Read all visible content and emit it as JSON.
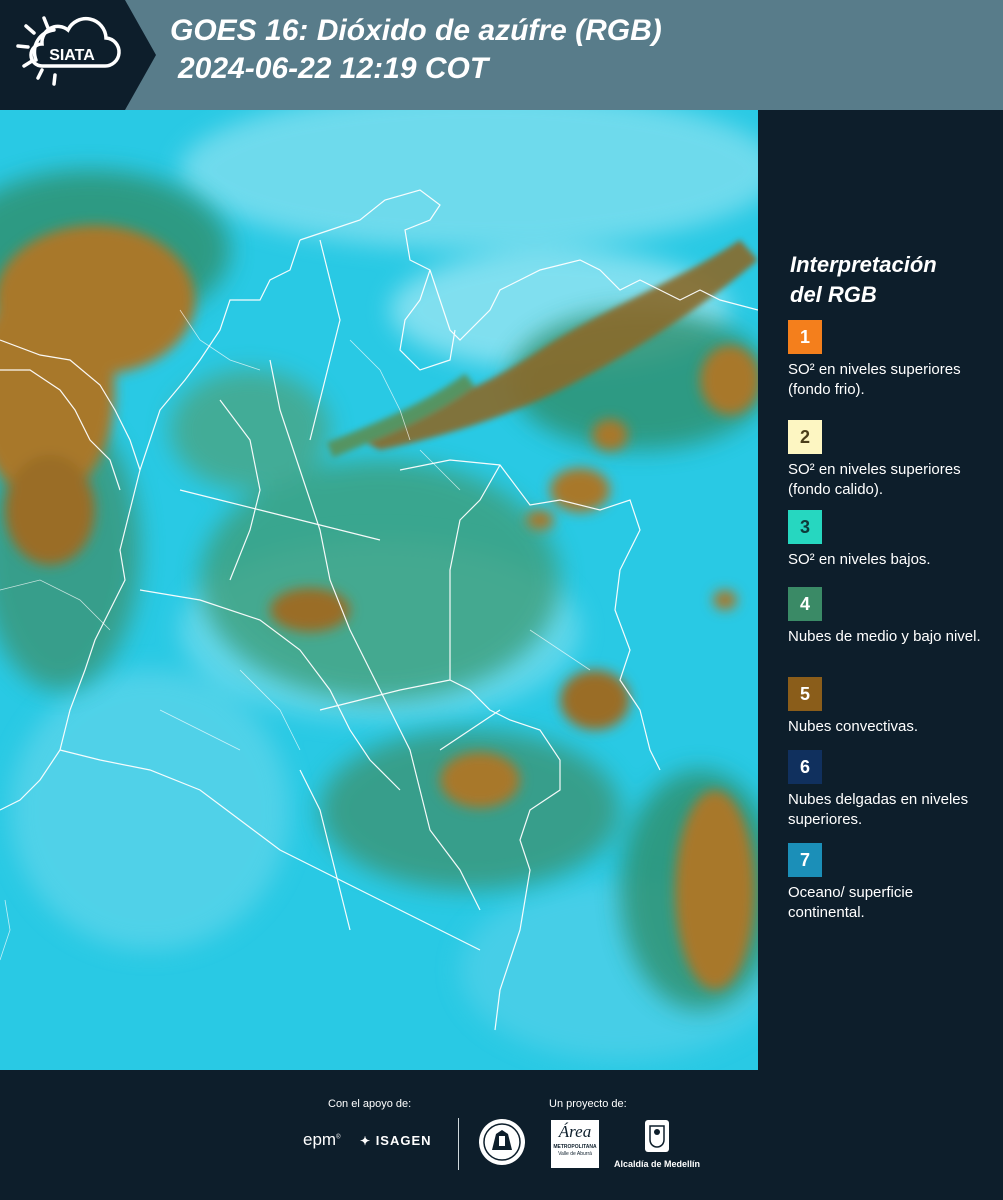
{
  "header": {
    "title": "GOES 16: Dióxido de azúfre (RGB)",
    "datetime": "2024-06-22 12:19 COT",
    "logo_text": "SIATA"
  },
  "legend": {
    "title_line1": "Interpretación",
    "title_line2": "del RGB",
    "items": [
      {
        "number": "1",
        "color": "#f47f1c",
        "num_color": "#ffffff",
        "text": "SO² en niveles superiores (fondo frio)."
      },
      {
        "number": "2",
        "color": "#fdf6c2",
        "num_color": "#4a3d1a",
        "text": "SO² en niveles superiores (fondo calido)."
      },
      {
        "number": "3",
        "color": "#26d7c0",
        "num_color": "#0d3b3a",
        "text": "SO² en niveles bajos."
      },
      {
        "number": "4",
        "color": "#3a8a66",
        "num_color": "#ffffff",
        "text": "Nubes de medio y bajo nivel."
      },
      {
        "number": "5",
        "color": "#8a5d1a",
        "num_color": "#ffffff",
        "text": "Nubes convectivas."
      },
      {
        "number": "6",
        "color": "#10305e",
        "num_color": "#ffffff",
        "text": "Nubes delgadas en niveles superiores."
      },
      {
        "number": "7",
        "color": "#1b8fb8",
        "num_color": "#ffffff",
        "text": "Oceano/ superficie continental."
      }
    ]
  },
  "footer": {
    "support_label": "Con el apoyo de:",
    "project_label": "Un proyecto de:",
    "sponsor_epm": "epm",
    "sponsor_isagen": "ISAGEN",
    "partner_area_word": "Área",
    "partner_area_sub1": "METROPOLITANA",
    "partner_area_sub2": "Valle de Aburrá",
    "partner_alcaldia": "Alcaldía de Medellín"
  },
  "colors": {
    "header_bg": "#587c8a",
    "panel_bg": "#0d1e2b",
    "map_base": "#27c8e3"
  }
}
